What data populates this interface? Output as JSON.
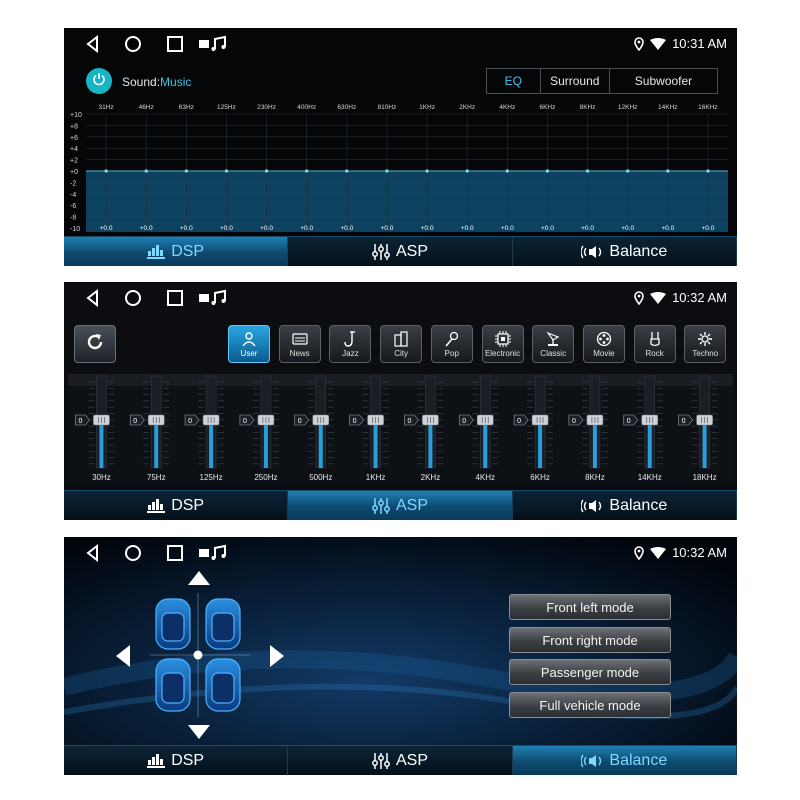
{
  "status": {
    "time_1": "10:31 AM",
    "time_2": "10:32 AM",
    "time_3": "10:32 AM"
  },
  "tabs": {
    "dsp": "DSP",
    "asp": "ASP",
    "balance": "Balance"
  },
  "eq_screen": {
    "sound_prefix": "Sound:",
    "sound_mode": "Music",
    "modes": [
      "EQ",
      "Surround",
      "Subwoofer"
    ],
    "active_mode": "EQ",
    "freq_labels": [
      "31Hz",
      "46Hz",
      "63Hz",
      "125Hz",
      "230Hz",
      "400Hz",
      "630Hz",
      "810Hz",
      "1KHz",
      "2KHz",
      "4KHz",
      "6KHz",
      "8KHz",
      "12KHz",
      "14KHz",
      "16KHz"
    ],
    "db_labels": [
      "+10",
      "+8",
      "+6",
      "+4",
      "+2",
      "+0",
      "-2",
      "-4",
      "-6",
      "-8",
      "-10"
    ],
    "band_values": [
      "+0.0",
      "+0.0",
      "+0.0",
      "+0.0",
      "+0.0",
      "+0.0",
      "+0.0",
      "+0.0",
      "+0.0",
      "+0.0",
      "+0.0",
      "+0.0",
      "+0.0",
      "+0.0",
      "+0.0",
      "+0.0"
    ],
    "band_levels_db": [
      0,
      0,
      0,
      0,
      0,
      0,
      0,
      0,
      0,
      0,
      0,
      0,
      0,
      0,
      0,
      0
    ],
    "accent_color": "#3fc3e8"
  },
  "asp_screen": {
    "presets": [
      {
        "label": "User",
        "icon": "user-icon"
      },
      {
        "label": "News",
        "icon": "news-icon"
      },
      {
        "label": "Jazz",
        "icon": "saxophone-icon"
      },
      {
        "label": "City",
        "icon": "city-icon"
      },
      {
        "label": "Pop",
        "icon": "microphone-icon"
      },
      {
        "label": "Electronic",
        "icon": "chip-icon"
      },
      {
        "label": "Classic",
        "icon": "gramophone-icon"
      },
      {
        "label": "Movie",
        "icon": "film-reel-icon"
      },
      {
        "label": "Rock",
        "icon": "rock-hand-icon"
      },
      {
        "label": "Techno",
        "icon": "gear-icon"
      }
    ],
    "active_preset": "User",
    "slider_freqs": [
      "30Hz",
      "75Hz",
      "125Hz",
      "250Hz",
      "500Hz",
      "1KHz",
      "2KHz",
      "4KHz",
      "6KHz",
      "8KHz",
      "14KHz",
      "18KHz"
    ],
    "slider_values": [
      "0",
      "0",
      "0",
      "0",
      "0",
      "0",
      "0",
      "0",
      "0",
      "0",
      "0",
      "0"
    ]
  },
  "balance_screen": {
    "modes": [
      "Front left mode",
      "Front right mode",
      "Passenger mode",
      "Full vehicle mode"
    ]
  }
}
